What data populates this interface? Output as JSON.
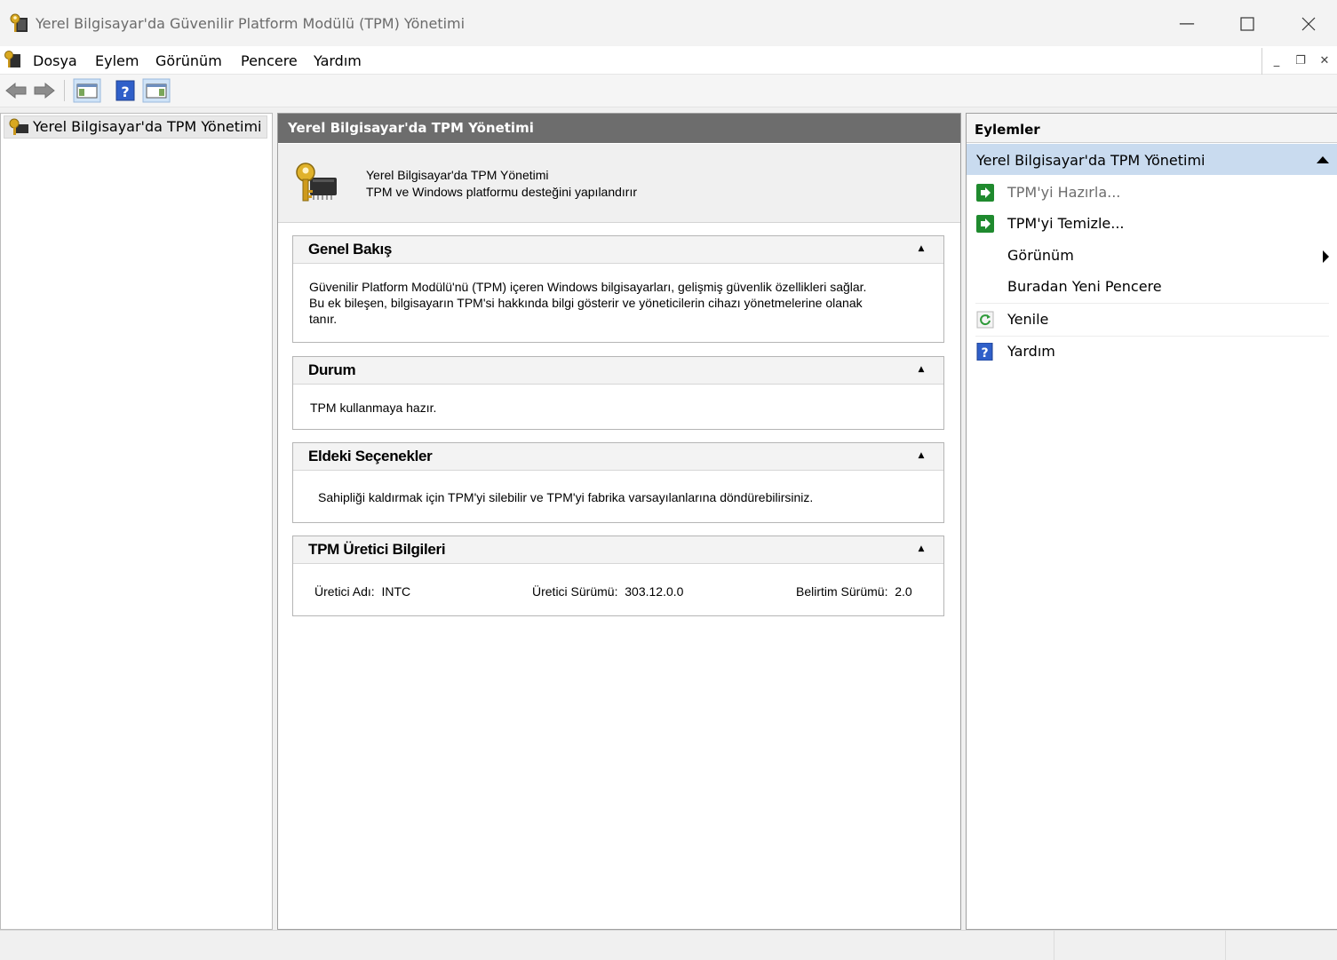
{
  "window": {
    "title": "Yerel Bilgisayar'da Güvenilir Platform Modülü (TPM) Yönetimi"
  },
  "menu": [
    "Dosya",
    "Eylem",
    "Görünüm",
    "Pencere",
    "Yardım"
  ],
  "tree": {
    "root_label": "Yerel Bilgisayar'da TPM Yönetimi"
  },
  "center": {
    "header": "Yerel Bilgisayar'da TPM Yönetimi",
    "intro_line1": "Yerel Bilgisayar'da TPM Yönetimi",
    "intro_line2": "TPM ve Windows platformu desteğini yapılandırır",
    "sections": {
      "overview": {
        "title": "Genel Bakış",
        "lines": [
          "Güvenilir Platform Modülü'nü (TPM) içeren Windows bilgisayarları, gelişmiş güvenlik özellikleri sağlar.",
          "Bu ek bileşen, bilgisayarın TPM'si hakkında bilgi gösterir ve yöneticilerin cihazı yönetmelerine olanak",
          "tanır."
        ]
      },
      "status": {
        "title": "Durum",
        "text": "TPM kullanmaya hazır."
      },
      "options": {
        "title": "Eldeki Seçenekler",
        "text": "Sahipliği kaldırmak için TPM'yi silebilir ve TPM'yi fabrika varsayılanlarına döndürebilirsiniz."
      },
      "manufacturer": {
        "title": "TPM Üretici Bilgileri",
        "name_label": "Üretici Adı:",
        "name_value": "INTC",
        "version_label": "Üretici Sürümü:",
        "version_value": "303.12.0.0",
        "spec_label": "Belirtim Sürümü:",
        "spec_value": "2.0"
      }
    }
  },
  "actions": {
    "title": "Eylemler",
    "group": "Yerel Bilgisayar'da TPM Yönetimi",
    "items": [
      {
        "label": "TPM'yi Hazırla...",
        "icon": "green-arrow-icon",
        "enabled": false
      },
      {
        "label": "TPM'yi Temizle...",
        "icon": "green-arrow-icon",
        "enabled": true
      },
      {
        "label": "Görünüm",
        "icon": "",
        "enabled": true
      },
      {
        "label": "Buradan Yeni Pencere",
        "icon": "",
        "enabled": true
      },
      {
        "label": "Yenile",
        "icon": "refresh-icon",
        "enabled": true
      },
      {
        "label": "Yardım",
        "icon": "help-icon",
        "enabled": true
      }
    ]
  },
  "colors": {
    "center_header_bg": "#6d6d6d",
    "actions_group_bg": "#c9dbef",
    "disabled_text": "#6d6d6d",
    "action_green": "#1f8a2e",
    "help_blue": "#2f5fc9"
  }
}
